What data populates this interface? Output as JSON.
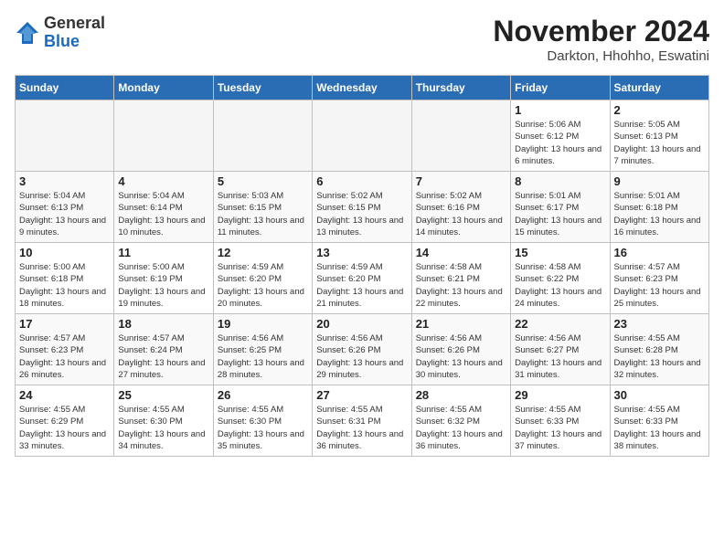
{
  "header": {
    "logo_general": "General",
    "logo_blue": "Blue",
    "title": "November 2024",
    "subtitle": "Darkton, Hhohho, Eswatini"
  },
  "weekdays": [
    "Sunday",
    "Monday",
    "Tuesday",
    "Wednesday",
    "Thursday",
    "Friday",
    "Saturday"
  ],
  "weeks": [
    [
      {
        "day": "",
        "info": ""
      },
      {
        "day": "",
        "info": ""
      },
      {
        "day": "",
        "info": ""
      },
      {
        "day": "",
        "info": ""
      },
      {
        "day": "",
        "info": ""
      },
      {
        "day": "1",
        "info": "Sunrise: 5:06 AM\nSunset: 6:12 PM\nDaylight: 13 hours and 6 minutes."
      },
      {
        "day": "2",
        "info": "Sunrise: 5:05 AM\nSunset: 6:13 PM\nDaylight: 13 hours and 7 minutes."
      }
    ],
    [
      {
        "day": "3",
        "info": "Sunrise: 5:04 AM\nSunset: 6:13 PM\nDaylight: 13 hours and 9 minutes."
      },
      {
        "day": "4",
        "info": "Sunrise: 5:04 AM\nSunset: 6:14 PM\nDaylight: 13 hours and 10 minutes."
      },
      {
        "day": "5",
        "info": "Sunrise: 5:03 AM\nSunset: 6:15 PM\nDaylight: 13 hours and 11 minutes."
      },
      {
        "day": "6",
        "info": "Sunrise: 5:02 AM\nSunset: 6:15 PM\nDaylight: 13 hours and 13 minutes."
      },
      {
        "day": "7",
        "info": "Sunrise: 5:02 AM\nSunset: 6:16 PM\nDaylight: 13 hours and 14 minutes."
      },
      {
        "day": "8",
        "info": "Sunrise: 5:01 AM\nSunset: 6:17 PM\nDaylight: 13 hours and 15 minutes."
      },
      {
        "day": "9",
        "info": "Sunrise: 5:01 AM\nSunset: 6:18 PM\nDaylight: 13 hours and 16 minutes."
      }
    ],
    [
      {
        "day": "10",
        "info": "Sunrise: 5:00 AM\nSunset: 6:18 PM\nDaylight: 13 hours and 18 minutes."
      },
      {
        "day": "11",
        "info": "Sunrise: 5:00 AM\nSunset: 6:19 PM\nDaylight: 13 hours and 19 minutes."
      },
      {
        "day": "12",
        "info": "Sunrise: 4:59 AM\nSunset: 6:20 PM\nDaylight: 13 hours and 20 minutes."
      },
      {
        "day": "13",
        "info": "Sunrise: 4:59 AM\nSunset: 6:20 PM\nDaylight: 13 hours and 21 minutes."
      },
      {
        "day": "14",
        "info": "Sunrise: 4:58 AM\nSunset: 6:21 PM\nDaylight: 13 hours and 22 minutes."
      },
      {
        "day": "15",
        "info": "Sunrise: 4:58 AM\nSunset: 6:22 PM\nDaylight: 13 hours and 24 minutes."
      },
      {
        "day": "16",
        "info": "Sunrise: 4:57 AM\nSunset: 6:23 PM\nDaylight: 13 hours and 25 minutes."
      }
    ],
    [
      {
        "day": "17",
        "info": "Sunrise: 4:57 AM\nSunset: 6:23 PM\nDaylight: 13 hours and 26 minutes."
      },
      {
        "day": "18",
        "info": "Sunrise: 4:57 AM\nSunset: 6:24 PM\nDaylight: 13 hours and 27 minutes."
      },
      {
        "day": "19",
        "info": "Sunrise: 4:56 AM\nSunset: 6:25 PM\nDaylight: 13 hours and 28 minutes."
      },
      {
        "day": "20",
        "info": "Sunrise: 4:56 AM\nSunset: 6:26 PM\nDaylight: 13 hours and 29 minutes."
      },
      {
        "day": "21",
        "info": "Sunrise: 4:56 AM\nSunset: 6:26 PM\nDaylight: 13 hours and 30 minutes."
      },
      {
        "day": "22",
        "info": "Sunrise: 4:56 AM\nSunset: 6:27 PM\nDaylight: 13 hours and 31 minutes."
      },
      {
        "day": "23",
        "info": "Sunrise: 4:55 AM\nSunset: 6:28 PM\nDaylight: 13 hours and 32 minutes."
      }
    ],
    [
      {
        "day": "24",
        "info": "Sunrise: 4:55 AM\nSunset: 6:29 PM\nDaylight: 13 hours and 33 minutes."
      },
      {
        "day": "25",
        "info": "Sunrise: 4:55 AM\nSunset: 6:30 PM\nDaylight: 13 hours and 34 minutes."
      },
      {
        "day": "26",
        "info": "Sunrise: 4:55 AM\nSunset: 6:30 PM\nDaylight: 13 hours and 35 minutes."
      },
      {
        "day": "27",
        "info": "Sunrise: 4:55 AM\nSunset: 6:31 PM\nDaylight: 13 hours and 36 minutes."
      },
      {
        "day": "28",
        "info": "Sunrise: 4:55 AM\nSunset: 6:32 PM\nDaylight: 13 hours and 36 minutes."
      },
      {
        "day": "29",
        "info": "Sunrise: 4:55 AM\nSunset: 6:33 PM\nDaylight: 13 hours and 37 minutes."
      },
      {
        "day": "30",
        "info": "Sunrise: 4:55 AM\nSunset: 6:33 PM\nDaylight: 13 hours and 38 minutes."
      }
    ]
  ]
}
